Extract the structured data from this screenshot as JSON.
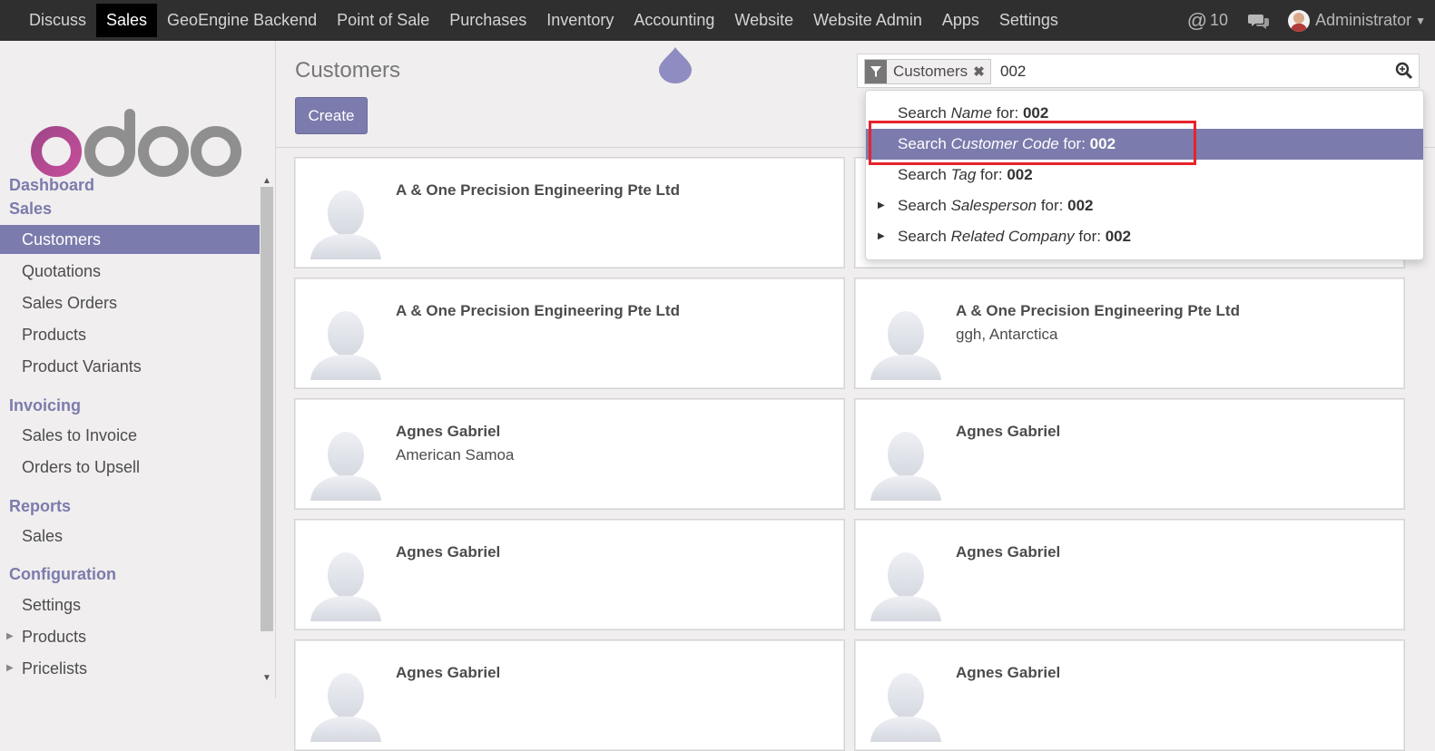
{
  "topnav": {
    "menus": [
      "Discuss",
      "Sales",
      "GeoEngine Backend",
      "Point of Sale",
      "Purchases",
      "Inventory",
      "Accounting",
      "Website",
      "Website Admin",
      "Apps",
      "Settings"
    ],
    "active": "Sales",
    "mention_count": "10",
    "user_name": "Administrator"
  },
  "sidebar": {
    "logo_text": "odoo",
    "dashboard": "Dashboard",
    "sales_title": "Sales",
    "sales_items": [
      "Customers",
      "Quotations",
      "Sales Orders",
      "Products",
      "Product Variants"
    ],
    "invoicing_title": "Invoicing",
    "invoicing_items": [
      "Sales to Invoice",
      "Orders to Upsell"
    ],
    "reports_title": "Reports",
    "reports_items": [
      "Sales"
    ],
    "config_title": "Configuration",
    "config_items": [
      "Settings",
      "Products",
      "Pricelists"
    ]
  },
  "control": {
    "title": "Customers",
    "create_label": "Create",
    "facet_label": "Customers",
    "search_value": "002"
  },
  "dropdown": {
    "items": [
      {
        "prefix": "Search ",
        "field": "Name",
        "middle": " for: ",
        "value": "002"
      },
      {
        "prefix": "Search ",
        "field": "Customer Code",
        "middle": " for: ",
        "value": "002"
      },
      {
        "prefix": "Search ",
        "field": "Tag",
        "middle": " for: ",
        "value": "002"
      },
      {
        "prefix": "Search ",
        "field": "Salesperson",
        "middle": " for: ",
        "value": "002"
      },
      {
        "prefix": "Search ",
        "field": "Related Company",
        "middle": " for: ",
        "value": "002"
      }
    ]
  },
  "cards": [
    {
      "name": "A & One Precision Engineering Pte Ltd",
      "sub": ""
    },
    {
      "name": "",
      "sub": ""
    },
    {
      "name": "A & One Precision Engineering Pte Ltd",
      "sub": ""
    },
    {
      "name": "A & One Precision Engineering Pte Ltd",
      "sub": "ggh, Antarctica"
    },
    {
      "name": "Agnes Gabriel",
      "sub": "American Samoa"
    },
    {
      "name": "Agnes Gabriel",
      "sub": ""
    },
    {
      "name": "Agnes Gabriel",
      "sub": ""
    },
    {
      "name": "Agnes Gabriel",
      "sub": ""
    },
    {
      "name": "Agnes Gabriel",
      "sub": ""
    },
    {
      "name": "Agnes Gabriel",
      "sub": ""
    }
  ],
  "colors": {
    "brand": "#7c7bad",
    "nav_bg": "#2f2f2f",
    "highlight_box": "#e8232a"
  }
}
